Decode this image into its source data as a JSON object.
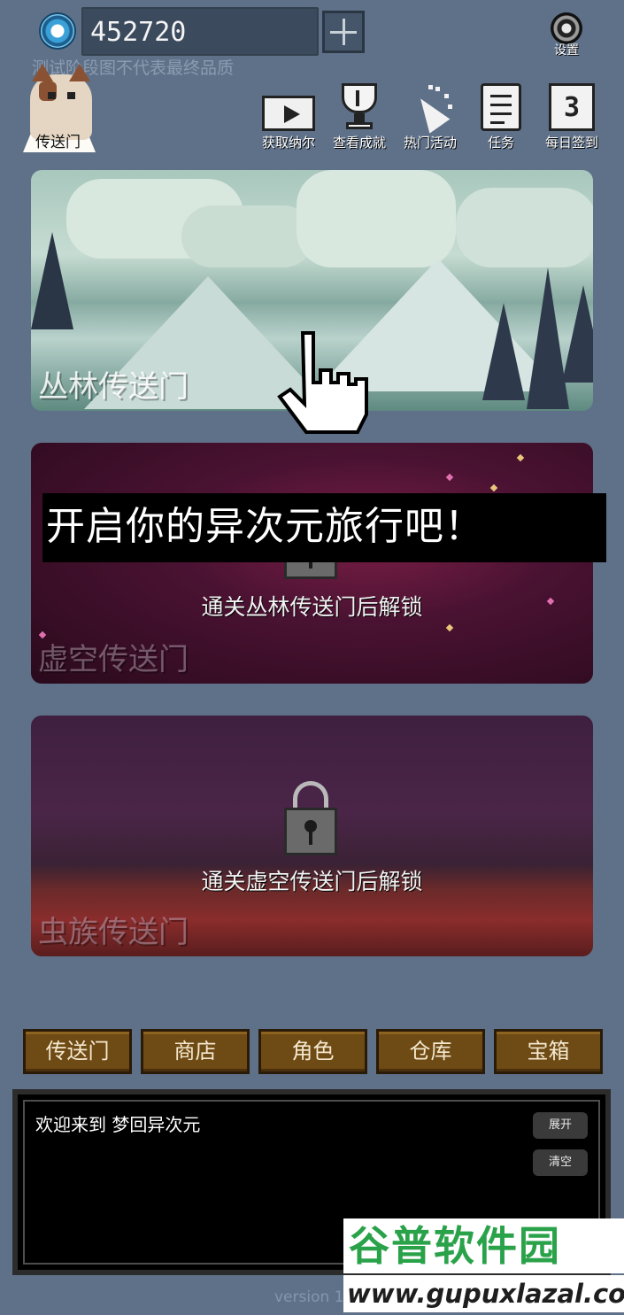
{
  "top_bar": {
    "currency_value": "452720",
    "settings_label": "设置",
    "disclaimer": "测试阶段图不代表最终品质"
  },
  "portal_shortcut": {
    "label": "传送门"
  },
  "top_menu": [
    {
      "label": "获取纳尔",
      "icon": "video-icon"
    },
    {
      "label": "查看成就",
      "icon": "trophy-icon"
    },
    {
      "label": "热门活动",
      "icon": "party-popper-icon"
    },
    {
      "label": "任务",
      "icon": "scroll-icon"
    },
    {
      "label": "每日签到",
      "icon": "calendar-icon",
      "icon_text": "3"
    }
  ],
  "portals": [
    {
      "title": "丛林传送门",
      "locked": false
    },
    {
      "title": "虚空传送门",
      "locked": true,
      "unlock_hint": "通关丛林传送门后解锁"
    },
    {
      "title": "虫族传送门",
      "locked": true,
      "unlock_hint": "通关虚空传送门后解锁"
    }
  ],
  "banner": {
    "text": "开启你的异次元旅行吧！"
  },
  "bottom_nav": [
    "传送门",
    "商店",
    "角色",
    "仓库",
    "宝箱"
  ],
  "log_panel": {
    "message": "欢迎来到 梦回异次元",
    "expand_label": "展开",
    "clear_label": "清空"
  },
  "footer": {
    "version": "version 1."
  },
  "watermark": {
    "title": "谷普软件园",
    "url": "www.gupuxlazal.com"
  },
  "colors": {
    "background": "#5f7189",
    "nav_button": "#6e4a14",
    "watermark_green": "#2aa24a"
  }
}
